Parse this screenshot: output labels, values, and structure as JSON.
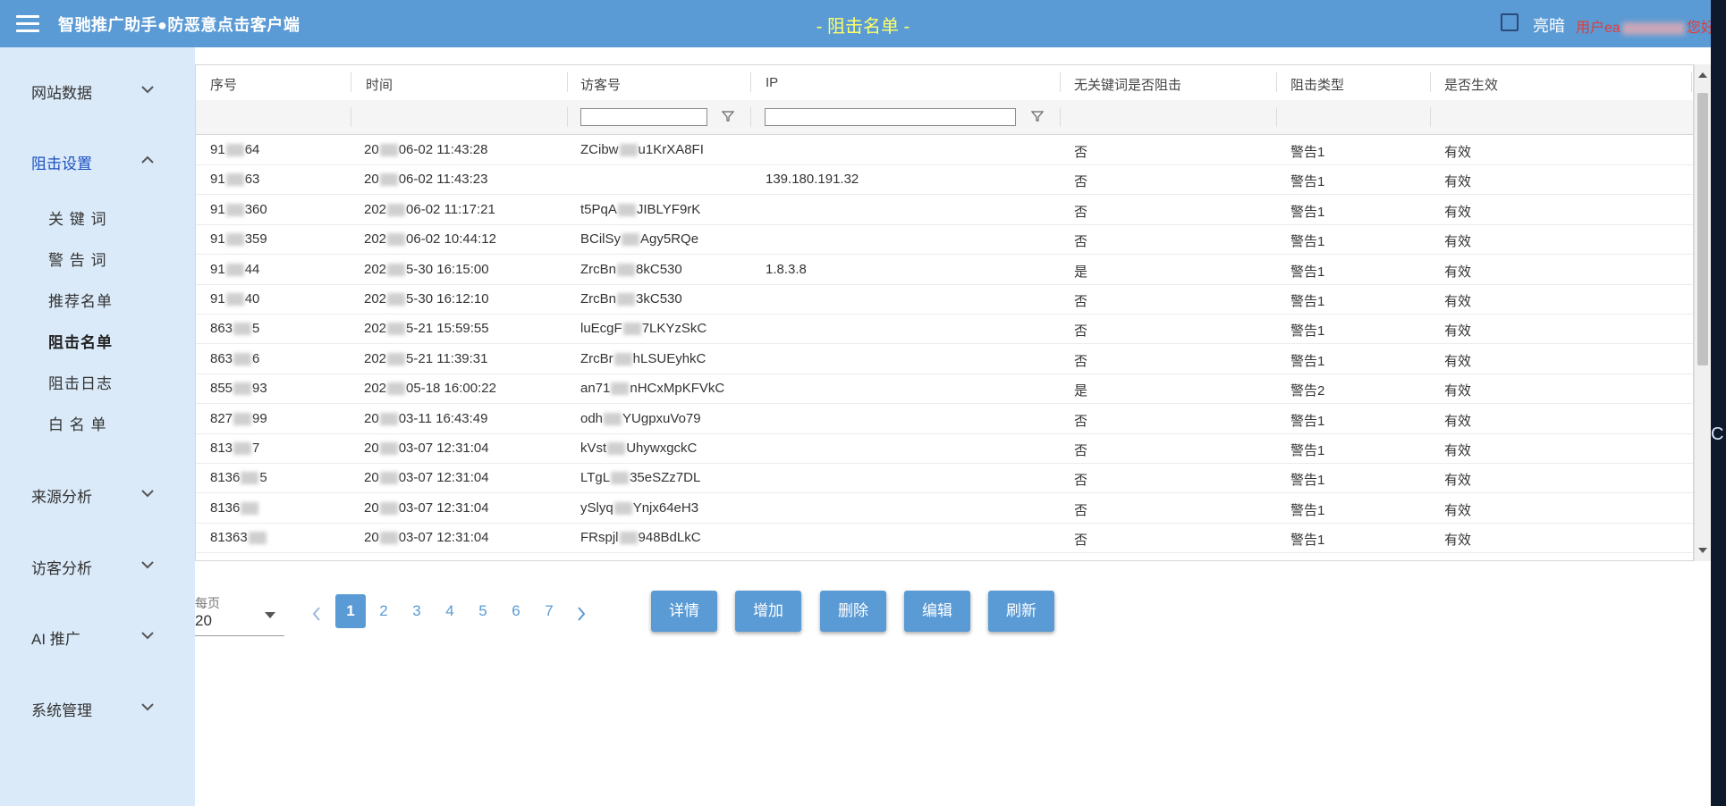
{
  "header": {
    "app_title": "智驰推广助手●防恶意点击客户端",
    "page_title": "- 阻击名单 -",
    "dark_mode_label": "亮暗",
    "user_prefix": "用户ea",
    "user_suffix": "您好"
  },
  "sidebar": {
    "groups": [
      {
        "label": "网站数据"
      },
      {
        "label": "阻击设置"
      },
      {
        "label": "来源分析"
      },
      {
        "label": "访客分析"
      },
      {
        "label": "AI 推广"
      },
      {
        "label": "系统管理"
      }
    ],
    "sub_items": [
      "关 键 词",
      "警 告 词",
      "推荐名单",
      "阻击名单",
      "阻击日志",
      "白 名 单"
    ]
  },
  "table": {
    "columns": [
      "序号",
      "时间",
      "访客号",
      "IP",
      "无关键词是否阻击",
      "阻击类型",
      "是否生效"
    ],
    "rows": [
      {
        "id_a": "91",
        "id_b": "64",
        "time_a": "20",
        "time_b": "06-02 11:43:28",
        "visitor_a": "ZCibw",
        "visitor_b": "u1KrXA8FI",
        "ip": "",
        "block": "否",
        "type": "警告1",
        "effective": "有效"
      },
      {
        "id_a": "91",
        "id_b": "63",
        "time_a": "20",
        "time_b": "06-02 11:43:23",
        "visitor_a": "",
        "visitor_b": "",
        "ip": "139.180.191.32",
        "block": "否",
        "type": "警告1",
        "effective": "有效"
      },
      {
        "id_a": "91",
        "id_b": "360",
        "time_a": "202",
        "time_b": "06-02 11:17:21",
        "visitor_a": "t5PqA",
        "visitor_b": "JIBLYF9rK",
        "ip": "",
        "block": "否",
        "type": "警告1",
        "effective": "有效"
      },
      {
        "id_a": "91",
        "id_b": "359",
        "time_a": "202",
        "time_b": "06-02 10:44:12",
        "visitor_a": "BCilSy",
        "visitor_b": "Agy5RQe",
        "ip": "",
        "block": "否",
        "type": "警告1",
        "effective": "有效"
      },
      {
        "id_a": "91",
        "id_b": "44",
        "time_a": "202",
        "time_b": "5-30 16:15:00",
        "visitor_a": "ZrcBn",
        "visitor_b": "8kC530",
        "ip": "1.8.3.8",
        "block": "是",
        "type": "警告1",
        "effective": "有效"
      },
      {
        "id_a": "91",
        "id_b": "40",
        "time_a": "202",
        "time_b": "5-30 16:12:10",
        "visitor_a": "ZrcBn",
        "visitor_b": "3kC530",
        "ip": "",
        "block": "否",
        "type": "警告1",
        "effective": "有效"
      },
      {
        "id_a": "863",
        "id_b": "5",
        "time_a": "202",
        "time_b": "5-21 15:59:55",
        "visitor_a": "luEcgF",
        "visitor_b": "7LKYzSkC",
        "ip": "",
        "block": "否",
        "type": "警告1",
        "effective": "有效"
      },
      {
        "id_a": "863",
        "id_b": "6",
        "time_a": "202",
        "time_b": "5-21 11:39:31",
        "visitor_a": "ZrcBr",
        "visitor_b": "hLSUEyhkC",
        "ip": "",
        "block": "否",
        "type": "警告1",
        "effective": "有效"
      },
      {
        "id_a": "855",
        "id_b": "93",
        "time_a": "202",
        "time_b": "05-18 16:00:22",
        "visitor_a": "an71",
        "visitor_b": "nHCxMpKFVkC",
        "ip": "",
        "block": "是",
        "type": "警告2",
        "effective": "有效"
      },
      {
        "id_a": "827",
        "id_b": "99",
        "time_a": "20",
        "time_b": "03-11 16:43:49",
        "visitor_a": "odh",
        "visitor_b": "YUgpxuVo79",
        "ip": "",
        "block": "否",
        "type": "警告1",
        "effective": "有效"
      },
      {
        "id_a": "813",
        "id_b": "7",
        "time_a": "20",
        "time_b": "03-07 12:31:04",
        "visitor_a": "kVst",
        "visitor_b": "UhywxgckC",
        "ip": "",
        "block": "否",
        "type": "警告1",
        "effective": "有效"
      },
      {
        "id_a": "8136",
        "id_b": "5",
        "time_a": "20",
        "time_b": "03-07 12:31:04",
        "visitor_a": "LTgL",
        "visitor_b": "35eSZz7DL",
        "ip": "",
        "block": "否",
        "type": "警告1",
        "effective": "有效"
      },
      {
        "id_a": "8136",
        "id_b": "",
        "time_a": "20",
        "time_b": "03-07 12:31:04",
        "visitor_a": "ySlyq",
        "visitor_b": "Ynjx64eH3",
        "ip": "",
        "block": "否",
        "type": "警告1",
        "effective": "有效"
      },
      {
        "id_a": "81363",
        "id_b": "",
        "time_a": "20",
        "time_b": "03-07 12:31:04",
        "visitor_a": "FRspjl",
        "visitor_b": "948BdLkC",
        "ip": "",
        "block": "否",
        "type": "警告1",
        "effective": "有效"
      }
    ]
  },
  "pager": {
    "per_page_label": "每页",
    "per_page_value": "20",
    "pages": [
      "1",
      "2",
      "3",
      "4",
      "5",
      "6",
      "7"
    ],
    "current_page": "1"
  },
  "actions": [
    "详情",
    "增加",
    "删除",
    "编辑",
    "刷新"
  ],
  "edge_text": "C",
  "colors": {
    "accent": "#5b9bd5",
    "sidebar_bg": "#daeaf9",
    "title_yellow": "#ffff66",
    "user_red": "#e53935"
  },
  "icons": [
    "menu-icon",
    "chevron-down-icon",
    "chevron-up-icon",
    "filter-icon",
    "chevron-left-icon",
    "chevron-right-icon",
    "dropdown-caret-icon"
  ]
}
